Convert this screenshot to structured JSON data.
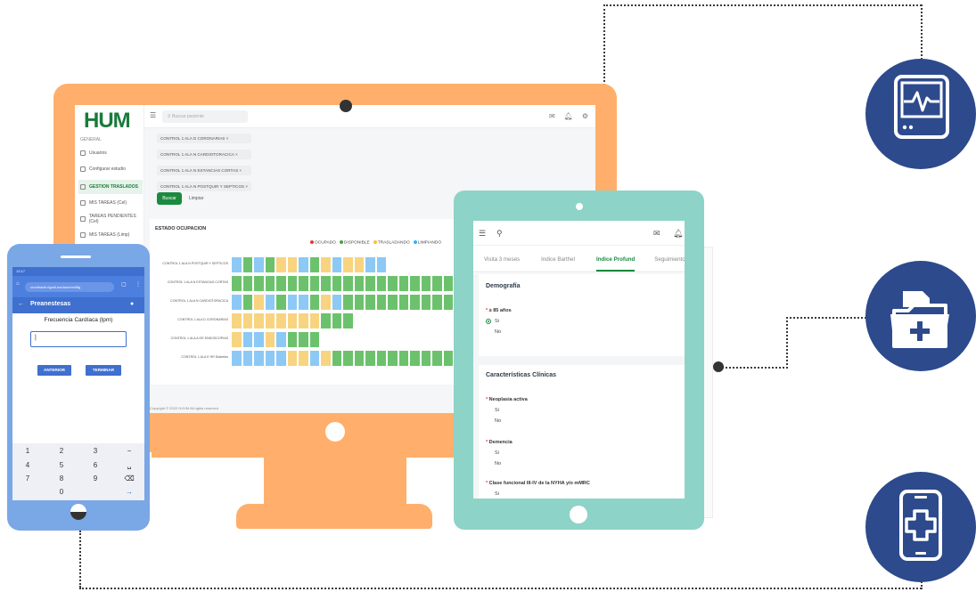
{
  "monitor": {
    "logo": "HUM",
    "search_placeholder": "Buscar paciente",
    "sidebar": {
      "title": "GENERAL",
      "items": [
        {
          "label": "Usuarios"
        },
        {
          "label": "Configurar estudio"
        },
        {
          "label": "GESTION TRASLADOS"
        },
        {
          "label": "MIS TAREAS (Cel)"
        },
        {
          "label": "TAREAS PENDIENTES (Cel)"
        },
        {
          "label": "MIS TAREAS (Limp)"
        }
      ]
    },
    "filter_tags": [
      "CONTROL 1 ALA D CORONARIAS ×",
      "CONTROL 1 ALA N CARDIOTORACICA ×",
      "CONTROL 1 ALA N ESTANCIAS CORTAS ×",
      "CONTROL 1 ALA N POSTQUIR Y SEPTICOS ×"
    ],
    "buscar_label": "Buscar",
    "limpiar_label": "Limpiar",
    "occupancy": {
      "title": "ESTADO OCUPACION",
      "legend": [
        {
          "label": "OCUPADO",
          "color": "#e53935"
        },
        {
          "label": "DISPONIBLE",
          "color": "#43a047"
        },
        {
          "label": "TRASLADANDO",
          "color": "#fbc02d"
        },
        {
          "label": "LIMPIANDO",
          "color": "#29b6f6"
        }
      ],
      "rows": [
        {
          "label": "CONTROL 1 ALA N POSTQUIR Y SEPTICOS",
          "cells": "BGBGYYBGYBYYBB"
        },
        {
          "label": "CONTROL 1 ALA N ESTANCIAS CORTAS",
          "cells": "GGGGGGGGGGGGGGGGGGGGGGGGGGGGGG"
        },
        {
          "label": "CONTROL 1 ALA N CARDIOTORACICA",
          "cells": "BGYBGBBGYBGGGGGGGGGGGGGGGGGGGG"
        },
        {
          "label": "CONTROL 1 ALA D CORONARIAS",
          "cells": "YYYYYYYYGGG"
        },
        {
          "label": "CONTROL 1 ALA A GE ENDOSCOPIAS",
          "cells": "YBBYBGGG"
        },
        {
          "label": "CONTROL 1 ALA E HR Diabetes",
          "cells": "BBBBBYYBYGGGGGGGGGGGGGGGGGGGGG"
        }
      ],
      "colors": {
        "G": "#6cc26c",
        "B": "#8cc9f5",
        "Y": "#f8d480"
      }
    },
    "footer": "Copyright © 2022 HUVM All rights reserved"
  },
  "tablet": {
    "tabs": [
      "Visita 3 meses",
      "Indice Barthel",
      "Indice Profund",
      "Seguimiento"
    ],
    "active_tab": "Indice Profund",
    "sections": [
      {
        "title": "Demografía",
        "questions": [
          {
            "label": "≥ 85 años",
            "options": [
              "Si",
              "No"
            ],
            "selected": "Si"
          }
        ]
      },
      {
        "title": "Características Clínicas",
        "questions": [
          {
            "label": "Neoplasia activa",
            "options": [
              "Si",
              "No"
            ]
          },
          {
            "label": "Demencia",
            "options": [
              "Si",
              "No"
            ]
          },
          {
            "label": "Clase funcional III-IV de la NYHA y/o mMRC",
            "options": [
              "Si"
            ]
          }
        ]
      }
    ]
  },
  "phone": {
    "status_time": "12:17",
    "url": "crontriarte.rigroll.es/dowr/red/flg",
    "appbar_title": "Preanestesas",
    "field_label": "Frecuencia Cardíaca (lpm)",
    "field_value": "|",
    "anterior_label": "ANTERIOR",
    "terminar_label": "TERMINAR",
    "keypad": [
      [
        "1",
        "2",
        "3",
        "−"
      ],
      [
        "4",
        "5",
        "6",
        "␣"
      ],
      [
        "7",
        "8",
        "9",
        "⌫"
      ],
      [
        "",
        "0",
        "",
        "→"
      ]
    ]
  },
  "features": [
    {
      "icon": "monitor-heartbeat-icon",
      "color": "#2d4a8c"
    },
    {
      "icon": "medical-folder-add-icon",
      "color": "#2d4a8c"
    },
    {
      "icon": "mobile-medical-cross-icon",
      "color": "#2d4a8c"
    }
  ]
}
